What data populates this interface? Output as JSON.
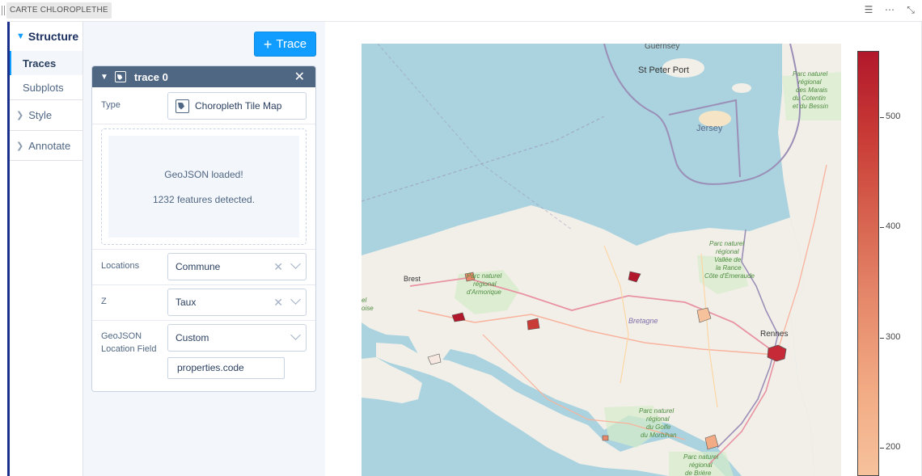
{
  "window": {
    "title": "CARTE CHLOROPLETHE",
    "icons": [
      "filter-icon",
      "more-icon",
      "expand-icon"
    ]
  },
  "nav": {
    "structure_label": "Structure",
    "traces_label": "Traces",
    "subplots_label": "Subplots",
    "style_label": "Style",
    "annotate_label": "Annotate"
  },
  "panel": {
    "add_trace_label": "Trace",
    "trace": {
      "title": "trace 0",
      "type_label": "Type",
      "type_value": "Choropleth Tile Map",
      "geojson_status": "GeoJSON loaded!",
      "features_detected": "1232 features detected.",
      "locations_label": "Locations",
      "locations_value": "Commune",
      "z_label": "Z",
      "z_value": "Taux",
      "location_field_label_1": "GeoJSON",
      "location_field_label_2": "Location Field",
      "location_field_value": "Custom",
      "location_field_path": "properties.code"
    }
  },
  "map": {
    "labels": {
      "guernsey": "Guernsey",
      "st_peter_port": "St Peter Port",
      "jersey": "Jersey",
      "brest": "Brest",
      "rennes": "Rennes",
      "bretagne": "Bretagne",
      "park_cotentin": [
        "Parc naturel",
        "régional",
        "des Marais",
        "du Cotentin",
        "et du Bessin"
      ],
      "park_armorique": [
        "Parc naturel",
        "régional",
        "d'Armorique"
      ],
      "park_rance": [
        "Parc naturel",
        "régional",
        "Vallée de",
        "la Rance",
        "Côte d'Émeraude"
      ],
      "park_morbihan": [
        "Parc naturel",
        "régional",
        "du Golfe",
        "du Morbihan"
      ],
      "park_briere": [
        "Parc naturel",
        "régional",
        "de Brière"
      ],
      "iroise": [
        "el",
        "oise"
      ]
    },
    "colors": {
      "sea": "#aad3df",
      "land": "#f2efe9",
      "accent": "#119dff",
      "high": "#b2182b",
      "low": "#f6c29c"
    }
  },
  "colorbar": {
    "ticks": [
      "500",
      "400",
      "300",
      "200"
    ]
  }
}
